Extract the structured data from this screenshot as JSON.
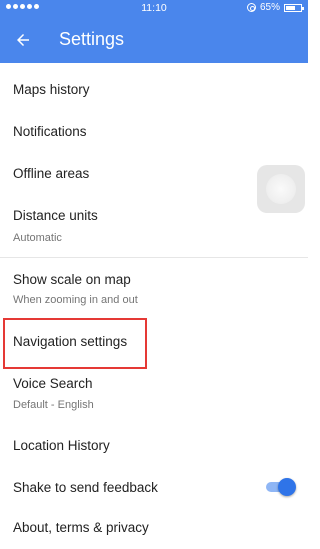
{
  "status_bar": {
    "time": "11:10",
    "battery_percent": "65%",
    "battery_level": 0.65
  },
  "app_bar": {
    "title": "Settings",
    "back_icon": "arrow-back-icon"
  },
  "settings": {
    "maps_history": "Maps history",
    "notifications": "Notifications",
    "offline_areas": "Offline areas",
    "distance_units": {
      "label": "Distance units",
      "value": "Automatic"
    },
    "show_scale": {
      "label": "Show scale on map",
      "value": "When zooming in and out"
    },
    "navigation_settings": "Navigation settings",
    "voice_search": {
      "label": "Voice Search",
      "value": "Default - English"
    },
    "location_history": "Location History",
    "shake_feedback": {
      "label": "Shake to send feedback",
      "enabled": true
    },
    "about": "About, terms & privacy"
  },
  "colors": {
    "app_bar": "#4a86ec",
    "highlight": "#e53935",
    "toggle_on": "#2f74e8"
  }
}
